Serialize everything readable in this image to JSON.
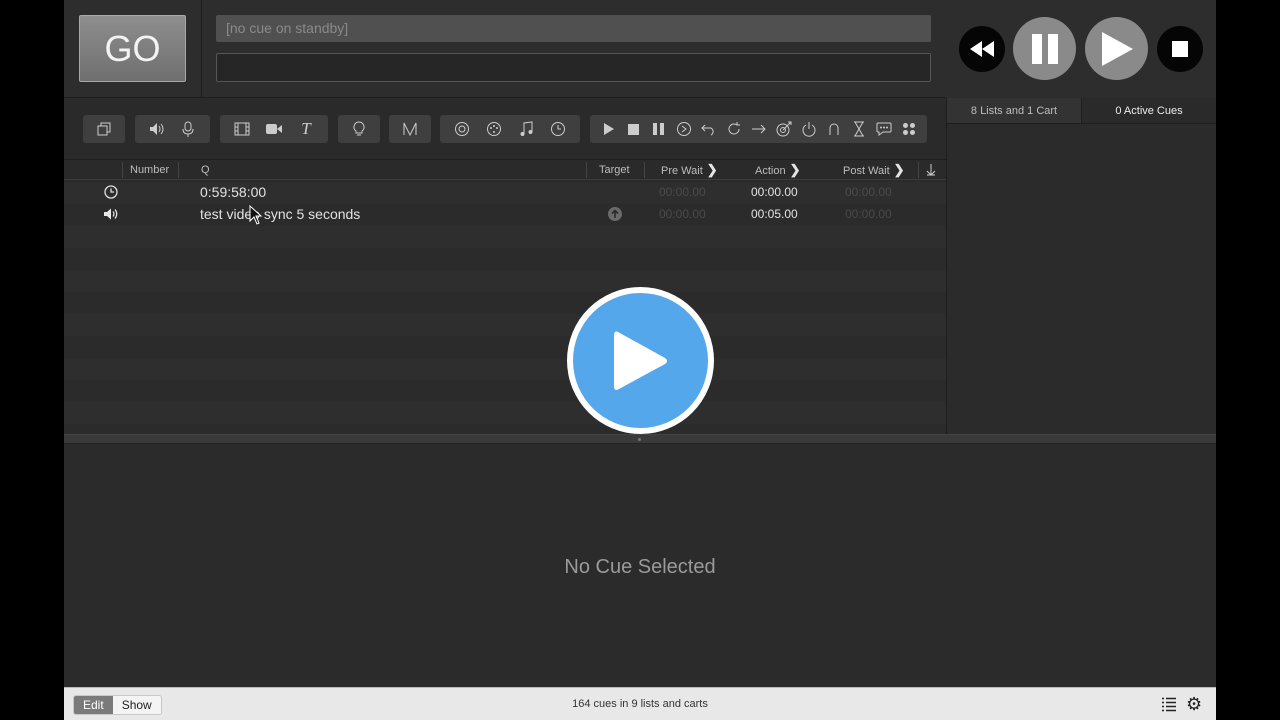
{
  "top": {
    "go_label": "GO",
    "standby_text": "[no cue on standby]",
    "notes_value": ""
  },
  "right_panel": {
    "tabs": [
      {
        "label": "8 Lists and 1 Cart"
      },
      {
        "label": "0 Active Cues"
      }
    ]
  },
  "cue_list": {
    "columns": {
      "number": "Number",
      "q": "Q",
      "target": "Target",
      "pre_wait": "Pre Wait",
      "action": "Action",
      "post_wait": "Post Wait"
    },
    "rows": [
      {
        "type_icon": "clock-icon",
        "number": "",
        "name": "0:59:58:00",
        "target": "",
        "pre_wait": "00:00.00",
        "action": "00:00.00",
        "post_wait": "00:00.00"
      },
      {
        "type_icon": "speaker-icon",
        "number": "",
        "name": "test video sync 5 seconds",
        "target": "target-arrow-icon",
        "pre_wait": "00:00.00",
        "action": "00:05.00",
        "post_wait": "00:00.00"
      }
    ]
  },
  "inspector": {
    "empty_text": "No Cue Selected"
  },
  "status_bar": {
    "edit_label": "Edit",
    "show_label": "Show",
    "summary": "164 cues in 9 lists and carts"
  },
  "colors": {
    "video_play": "#55a7ec",
    "background": "#2b2b2b"
  }
}
